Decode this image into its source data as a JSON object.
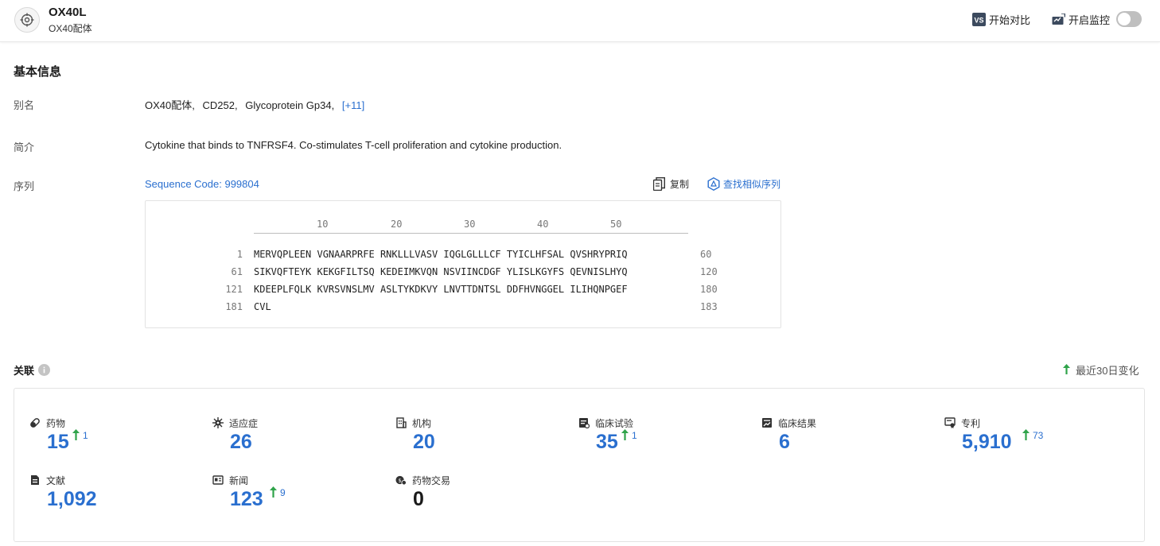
{
  "header": {
    "title": "OX40L",
    "subtitle": "OX40配体",
    "compare_badge": "VS",
    "compare_label": "开始对比",
    "monitor_label": "开启监控"
  },
  "basic": {
    "section_title": "基本信息",
    "alias_label": "别名",
    "aliases": [
      "OX40配体",
      "CD252",
      "Glycoprotein Gp34"
    ],
    "alias_more": "[+11]",
    "intro_label": "简介",
    "intro_text": "Cytokine that binds to TNFRSF4. Co-stimulates T-cell proliferation and cytokine production.",
    "sequence_label": "序列",
    "sequence_code": "Sequence Code: 999804",
    "copy_label": "复制",
    "find_similar_label": "查找相似序列"
  },
  "sequence": {
    "ruler": [
      "10",
      "20",
      "30",
      "40",
      "50"
    ],
    "rows": [
      {
        "start": "1",
        "seq": "MERVQPLEEN VGNAARPRFE RNKLLLVASV IQGLGLLLCF TYICLHFSAL QVSHRYPRIQ",
        "end": "60"
      },
      {
        "start": "61",
        "seq": "SIKVQFTEYK KEKGFILTSQ KEDEIMKVQN NSVIINCDGF YLISLKGYFS QEVNISLHYQ",
        "end": "120"
      },
      {
        "start": "121",
        "seq": "KDEEPLFQLK KVRSVNSLMV ASLTYKDKVY LNVTTDNTSL DDFHVNGGEL ILIHQNPGEF",
        "end": "180"
      },
      {
        "start": "181",
        "seq": "CVL",
        "end": "183"
      }
    ]
  },
  "related": {
    "section_title": "关联",
    "recent_label": "最近30日变化",
    "stats": [
      {
        "label": "药物",
        "value": "15",
        "delta": "1",
        "icon": "pill-icon"
      },
      {
        "label": "适应症",
        "value": "26",
        "delta": "",
        "icon": "virus-icon"
      },
      {
        "label": "机构",
        "value": "20",
        "delta": "",
        "icon": "building-icon"
      },
      {
        "label": "临床试验",
        "value": "35",
        "delta": "1",
        "icon": "clipboard-icon"
      },
      {
        "label": "临床结果",
        "value": "6",
        "delta": "",
        "icon": "chart-report-icon"
      },
      {
        "label": "专利",
        "value": "5,910",
        "delta": "73",
        "icon": "certificate-icon"
      },
      {
        "label": "文献",
        "value": "1,092",
        "delta": "",
        "icon": "document-icon"
      },
      {
        "label": "新闻",
        "value": "123",
        "delta": "9",
        "icon": "newspaper-icon"
      },
      {
        "label": "药物交易",
        "value": "0",
        "delta": "",
        "icon": "deal-icon"
      }
    ]
  }
}
